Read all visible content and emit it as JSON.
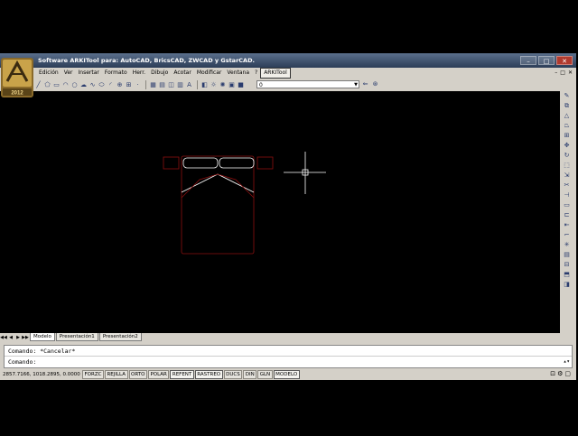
{
  "window": {
    "title": "Software ARKITool para: AutoCAD, BricsCAD, ZWCAD y GstarCAD.",
    "controls": [
      "–",
      "□",
      "✕"
    ]
  },
  "logo": {
    "year": "2012"
  },
  "menu": {
    "items": [
      "Edición",
      "Ver",
      "Insertar",
      "Formato",
      "Herr.",
      "Dibujo",
      "Acotar",
      "Modificar",
      "Ventana",
      "?",
      "ARKITool"
    ],
    "doc_controls": [
      "–",
      "□",
      "✕"
    ]
  },
  "layer": {
    "current": "0"
  },
  "tabs": {
    "nav": [
      "◀◀",
      "◀",
      "▶",
      "▶▶"
    ],
    "items": [
      "Modelo",
      "Presentación1",
      "Presentación2"
    ]
  },
  "command": {
    "line1": "Comando: *Cancelar*",
    "line2": "Comando:"
  },
  "status": {
    "coords": "2857.7166, 1018.2895, 0.0000",
    "toggles": [
      "FORZC",
      "REJILLA",
      "ORTO",
      "POLAR",
      "REFENT",
      "RASTREO",
      "DUCS",
      "DIN",
      "GLN",
      "MODELO"
    ]
  },
  "colors": {
    "canvas": "#000000",
    "bed_outline": "#8b1010",
    "pillow": "#ffffff",
    "crosshair": "#ffffff",
    "titlebar": "#3a4d6b"
  },
  "icons": {
    "toolbar_draw": [
      "line-icon",
      "circle-icon",
      "rectangle-icon",
      "arc-icon",
      "polygon-icon",
      "spline-icon",
      "ellipse-icon",
      "hatch-icon",
      "block-icon",
      "table-icon",
      "text-icon"
    ],
    "right_modify": [
      "erase-icon",
      "copy-icon",
      "mirror-icon",
      "offset-icon",
      "array-icon",
      "move-icon",
      "rotate-icon",
      "scale-icon",
      "stretch-icon",
      "trim-icon",
      "extend-icon",
      "break-icon",
      "join-icon",
      "chamfer-icon",
      "fillet-icon",
      "explode-icon"
    ]
  }
}
